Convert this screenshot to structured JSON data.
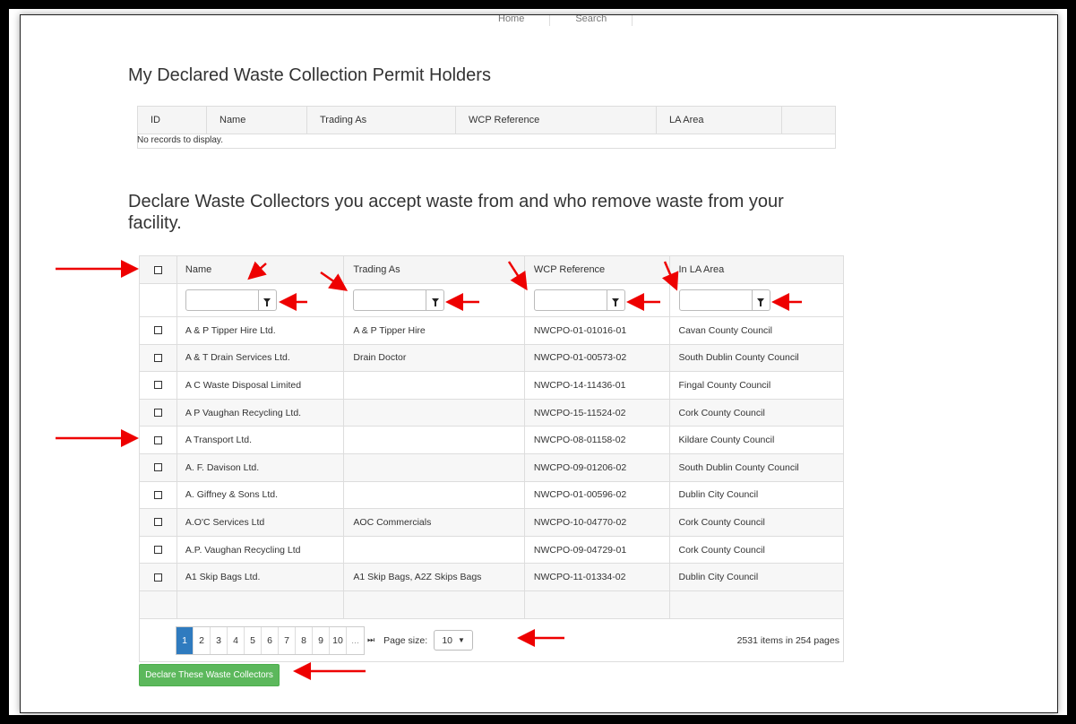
{
  "top_nav": [
    "Home",
    "Search"
  ],
  "section1": {
    "title": "My Declared Waste Collection Permit Holders",
    "columns": [
      "ID",
      "Name",
      "Trading As",
      "WCP Reference",
      "LA Area"
    ],
    "empty_message": "No records to display."
  },
  "section2": {
    "title": "Declare Waste Collectors you accept waste from and who remove waste from your facility.",
    "columns": [
      "Name",
      "Trading As",
      "WCP Reference",
      "In LA Area"
    ],
    "rows": [
      {
        "name": "A & P Tipper Hire Ltd.",
        "trading_as": "A & P Tipper Hire",
        "wcp": "NWCPO-01-01016-01",
        "la": "Cavan County Council"
      },
      {
        "name": "A & T Drain Services Ltd.",
        "trading_as": "Drain Doctor",
        "wcp": "NWCPO-01-00573-02",
        "la": "South Dublin County Council"
      },
      {
        "name": "A C Waste Disposal Limited",
        "trading_as": "",
        "wcp": "NWCPO-14-11436-01",
        "la": "Fingal County Council"
      },
      {
        "name": "A P Vaughan Recycling Ltd.",
        "trading_as": "",
        "wcp": "NWCPO-15-11524-02",
        "la": "Cork County Council"
      },
      {
        "name": "A Transport Ltd.",
        "trading_as": "",
        "wcp": "NWCPO-08-01158-02",
        "la": "Kildare County Council"
      },
      {
        "name": "A. F. Davison Ltd.",
        "trading_as": "",
        "wcp": "NWCPO-09-01206-02",
        "la": "South Dublin County Council"
      },
      {
        "name": "A. Giffney & Sons Ltd.",
        "trading_as": "",
        "wcp": "NWCPO-01-00596-02",
        "la": "Dublin City Council"
      },
      {
        "name": "A.O'C Services Ltd",
        "trading_as": "AOC Commercials",
        "wcp": "NWCPO-10-04770-02",
        "la": "Cork County Council"
      },
      {
        "name": "A.P. Vaughan Recycling Ltd",
        "trading_as": "",
        "wcp": "NWCPO-09-04729-01",
        "la": "Cork County Council"
      },
      {
        "name": "A1 Skip Bags Ltd.",
        "trading_as": "A1 Skip Bags, A2Z Skips Bags",
        "wcp": "NWCPO-11-01334-02",
        "la": "Dublin City Council"
      }
    ],
    "pager": {
      "pages": [
        "1",
        "2",
        "3",
        "4",
        "5",
        "6",
        "7",
        "8",
        "9",
        "10",
        "..."
      ],
      "last_icon": "⏭",
      "page_size_label": "Page size:",
      "page_size": "10",
      "info": "2531 items in 254 pages"
    },
    "declare_button": "Declare These Waste Collectors"
  },
  "annotation_color": "#ee0000",
  "accent": {
    "pager_current": "#2f7bbf",
    "button": "#5cb85c"
  }
}
